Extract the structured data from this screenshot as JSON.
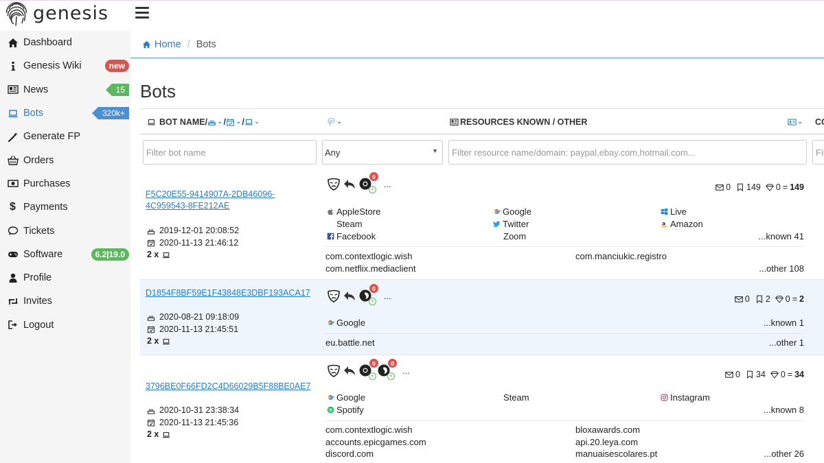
{
  "brand": {
    "name": "genesis"
  },
  "sidebar": {
    "items": [
      {
        "label": "Dashboard",
        "icon": "home-icon"
      },
      {
        "label": "Genesis Wiki",
        "icon": "info-icon",
        "badge": "new"
      },
      {
        "label": "News",
        "icon": "newspaper-icon",
        "badge": "15"
      },
      {
        "label": "Bots",
        "icon": "laptop-icon",
        "badge": "320k+",
        "active": true
      },
      {
        "label": "Generate FP",
        "icon": "magic-wand-icon"
      },
      {
        "label": "Orders",
        "icon": "basket-icon"
      },
      {
        "label": "Purchases",
        "icon": "money-icon"
      },
      {
        "label": "Payments",
        "icon": "dollar-icon"
      },
      {
        "label": "Tickets",
        "icon": "comment-icon"
      },
      {
        "label": "Software",
        "icon": "gamepad-icon",
        "badge": "6.2|19.0"
      },
      {
        "label": "Profile",
        "icon": "user-icon"
      },
      {
        "label": "Invites",
        "icon": "retweet-icon"
      },
      {
        "label": "Logout",
        "icon": "sign-out-icon"
      }
    ]
  },
  "breadcrumb": {
    "home": "Home",
    "sep": "/",
    "current": "Bots"
  },
  "page": {
    "title": "Bots"
  },
  "table": {
    "headers": {
      "botname": "BOT NAME/",
      "slash1": "/",
      "slash2": "/",
      "resources": "RESOURCES KNOWN / OTHER",
      "co": "CO"
    },
    "filters": {
      "botname_placeholder": "Filter bot name",
      "type_value": "Any",
      "resource_placeholder": "Filter resource name/domain: paypal,ebay.com,hotmail.com...",
      "last_placeholder": "Fil"
    },
    "rows": [
      {
        "id_line1": "F5C20E55-9414907A-2DB46096-",
        "id_line2": "4C959543-8FE212AE",
        "created": "2019-12-01 20:08:52",
        "updated": "2020-11-13 21:46:12",
        "count": "2 x",
        "bubbles": [
          "0"
        ],
        "dots": "...",
        "stats": {
          "mail": "0",
          "bookmark": "149",
          "diamond": "0",
          "eq": "=",
          "total": "149"
        },
        "known": [
          "AppleStore",
          "Google",
          "Live",
          "Steam",
          "Twitter",
          "Amazon",
          "Facebook",
          "Zoom"
        ],
        "known_more": "...known 41",
        "other": [
          "com.contextlogic.wish",
          "com.manciukic.registro",
          "com.netflix.mediaclient"
        ],
        "other_more": "...other 108"
      },
      {
        "id_line1": "D1854F8BF59E1F43848E3DBF193ACA17",
        "created": "2020-08-21 09:18:09",
        "updated": "2020-11-13 21:45:51",
        "count": "2 x",
        "bubbles": [
          "0"
        ],
        "dots": "...",
        "stats": {
          "mail": "0",
          "bookmark": "2",
          "diamond": "0",
          "eq": "=",
          "total": "2"
        },
        "known": [
          "Google"
        ],
        "known_more": "...known 1",
        "other": [
          "eu.battle.net"
        ],
        "other_more": "...other 1"
      },
      {
        "id_line1": "3796BE0F66FD2C4D66029B5F88BE0AE7",
        "created": "2020-10-31 23:38:34",
        "updated": "2020-11-13 21:45:36",
        "count": "2 x",
        "bubbles": [
          "0",
          "0"
        ],
        "dots": "...",
        "stats": {
          "mail": "0",
          "bookmark": "34",
          "diamond": "0",
          "eq": "=",
          "total": "34"
        },
        "known": [
          "Google",
          "Steam",
          "Instagram",
          "Spotify"
        ],
        "known_more": "...known 8",
        "other": [
          "com.contextlogic.wish",
          "bloxawards.com",
          "accounts.epicgames.com",
          "api.20.leya.com",
          "discord.com",
          "manuaisescolares.pt"
        ],
        "other_more": "...other 26"
      }
    ]
  },
  "colors": {
    "accent": "#2a7cc4",
    "badge_red": "#d9534f",
    "badge_green": "#5cb85c",
    "badge_blue": "#4a8fd4",
    "row_highlight": "#eef5fc"
  }
}
